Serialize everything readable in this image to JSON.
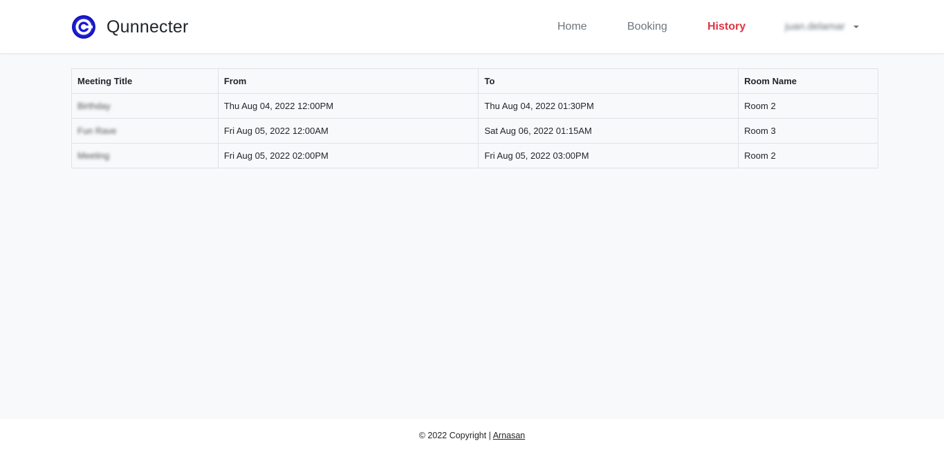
{
  "brand": {
    "name": "Qunnecter",
    "logo_icon": "q-ring-logo-icon",
    "logo_color": "#1a1adb"
  },
  "nav": {
    "home": "Home",
    "booking": "Booking",
    "history": "History",
    "active_color": "#dc3545",
    "user": "juan.delamar"
  },
  "table": {
    "headers": [
      "Meeting Title",
      "From",
      "To",
      "Room Name"
    ],
    "rows": [
      {
        "title": "Birthday",
        "from": "Thu Aug 04, 2022 12:00PM",
        "to": "Thu Aug 04, 2022 01:30PM",
        "room": "Room 2"
      },
      {
        "title": "Fun Rave",
        "from": "Fri Aug 05, 2022 12:00AM",
        "to": "Sat Aug 06, 2022 01:15AM",
        "room": "Room 3"
      },
      {
        "title": "Meeting",
        "from": "Fri Aug 05, 2022 02:00PM",
        "to": "Fri Aug 05, 2022 03:00PM",
        "room": "Room 2"
      }
    ]
  },
  "footer": {
    "text": "© 2022 Copyright | ",
    "link": "Arnasan"
  }
}
